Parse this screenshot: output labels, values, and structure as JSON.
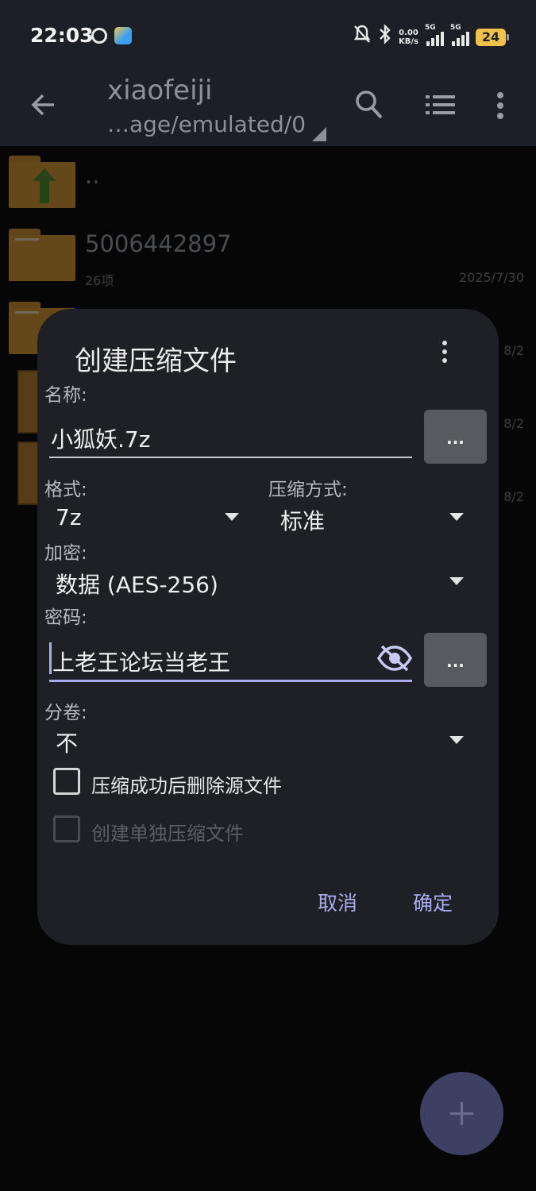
{
  "status_bar": {
    "time": "22:03",
    "net_speed_value": "0.00",
    "net_speed_unit": "KB/s",
    "signal1_label": "5G",
    "signal2_label": "5G",
    "battery": "24"
  },
  "app_bar": {
    "title": "xiaofeiji",
    "path": "…age/emulated/0"
  },
  "file_list": [
    {
      "name": "..",
      "meta": "",
      "date": ""
    },
    {
      "name": "5006442897",
      "meta": "26项",
      "date": "2025/7/30"
    },
    {
      "name": "",
      "meta": "",
      "date": "8/2"
    },
    {
      "name": "",
      "meta": "",
      "date": "8/2"
    },
    {
      "name": "",
      "meta": "",
      "date": "8/2"
    }
  ],
  "dialog": {
    "title": "创建压缩文件",
    "name_label": "名称:",
    "name_value": "小狐妖.7z",
    "browse_label": "...",
    "format_label": "格式:",
    "format_value": "7z",
    "compression_label": "压缩方式:",
    "compression_value": "标准",
    "encryption_label": "加密:",
    "encryption_value": "数据 (AES-256)",
    "password_label": "密码:",
    "password_value": "上老王论坛当老王",
    "password_more_label": "...",
    "volume_label": "分卷:",
    "volume_value": "不",
    "delete_source_label": "压缩成功后删除源文件",
    "delete_source_checked": false,
    "separate_archive_label": "创建单独压缩文件",
    "separate_archive_checked": false,
    "cancel_label": "取消",
    "ok_label": "确定"
  },
  "colors": {
    "accent": "#a9acf0",
    "dialog_bg": "#1f2026",
    "folder": "#b9842f",
    "fab": "#3d4063"
  }
}
